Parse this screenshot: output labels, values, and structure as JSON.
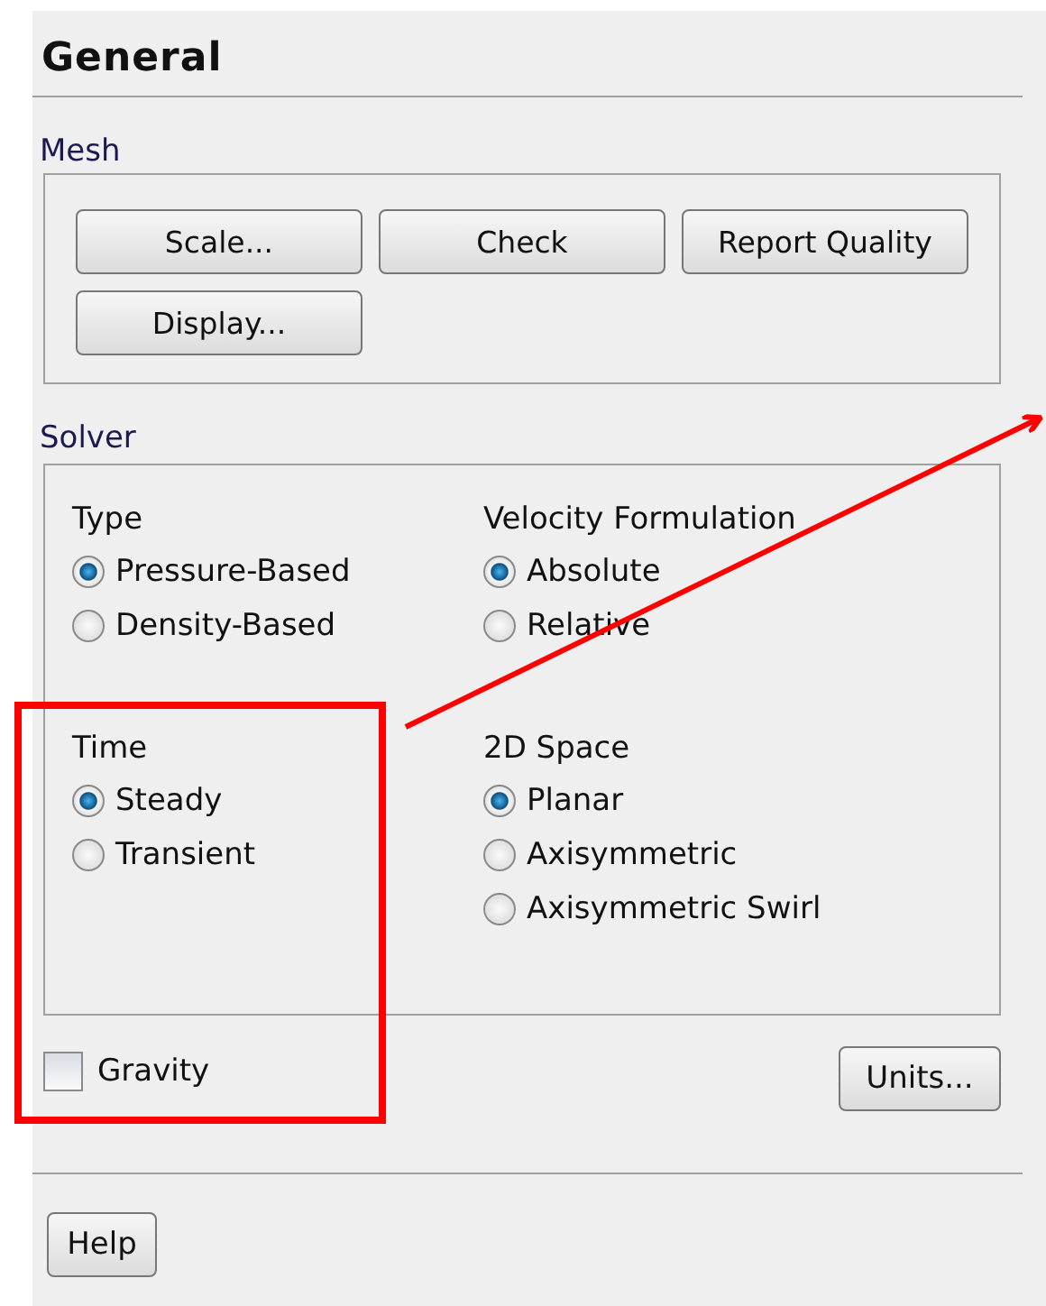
{
  "panel": {
    "title": "General"
  },
  "mesh": {
    "label": "Mesh",
    "buttons": [
      "Scale...",
      "Check",
      "Report Quality",
      "Display..."
    ]
  },
  "solver": {
    "label": "Solver",
    "groups": [
      {
        "label": "Type",
        "options": [
          {
            "label": "Pressure-Based",
            "selected": true
          },
          {
            "label": "Density-Based",
            "selected": false
          }
        ]
      },
      {
        "label": "Velocity Formulation",
        "options": [
          {
            "label": "Absolute",
            "selected": true
          },
          {
            "label": "Relative",
            "selected": false
          }
        ]
      },
      {
        "label": "Time",
        "options": [
          {
            "label": "Steady",
            "selected": true
          },
          {
            "label": "Transient",
            "selected": false
          }
        ]
      },
      {
        "label": "2D Space",
        "options": [
          {
            "label": "Planar",
            "selected": true
          },
          {
            "label": "Axisymmetric",
            "selected": false
          },
          {
            "label": "Axisymmetric Swirl",
            "selected": false
          }
        ]
      }
    ]
  },
  "gravity": {
    "label": "Gravity",
    "checked": false
  },
  "units_button": "Units...",
  "help_button": "Help"
}
